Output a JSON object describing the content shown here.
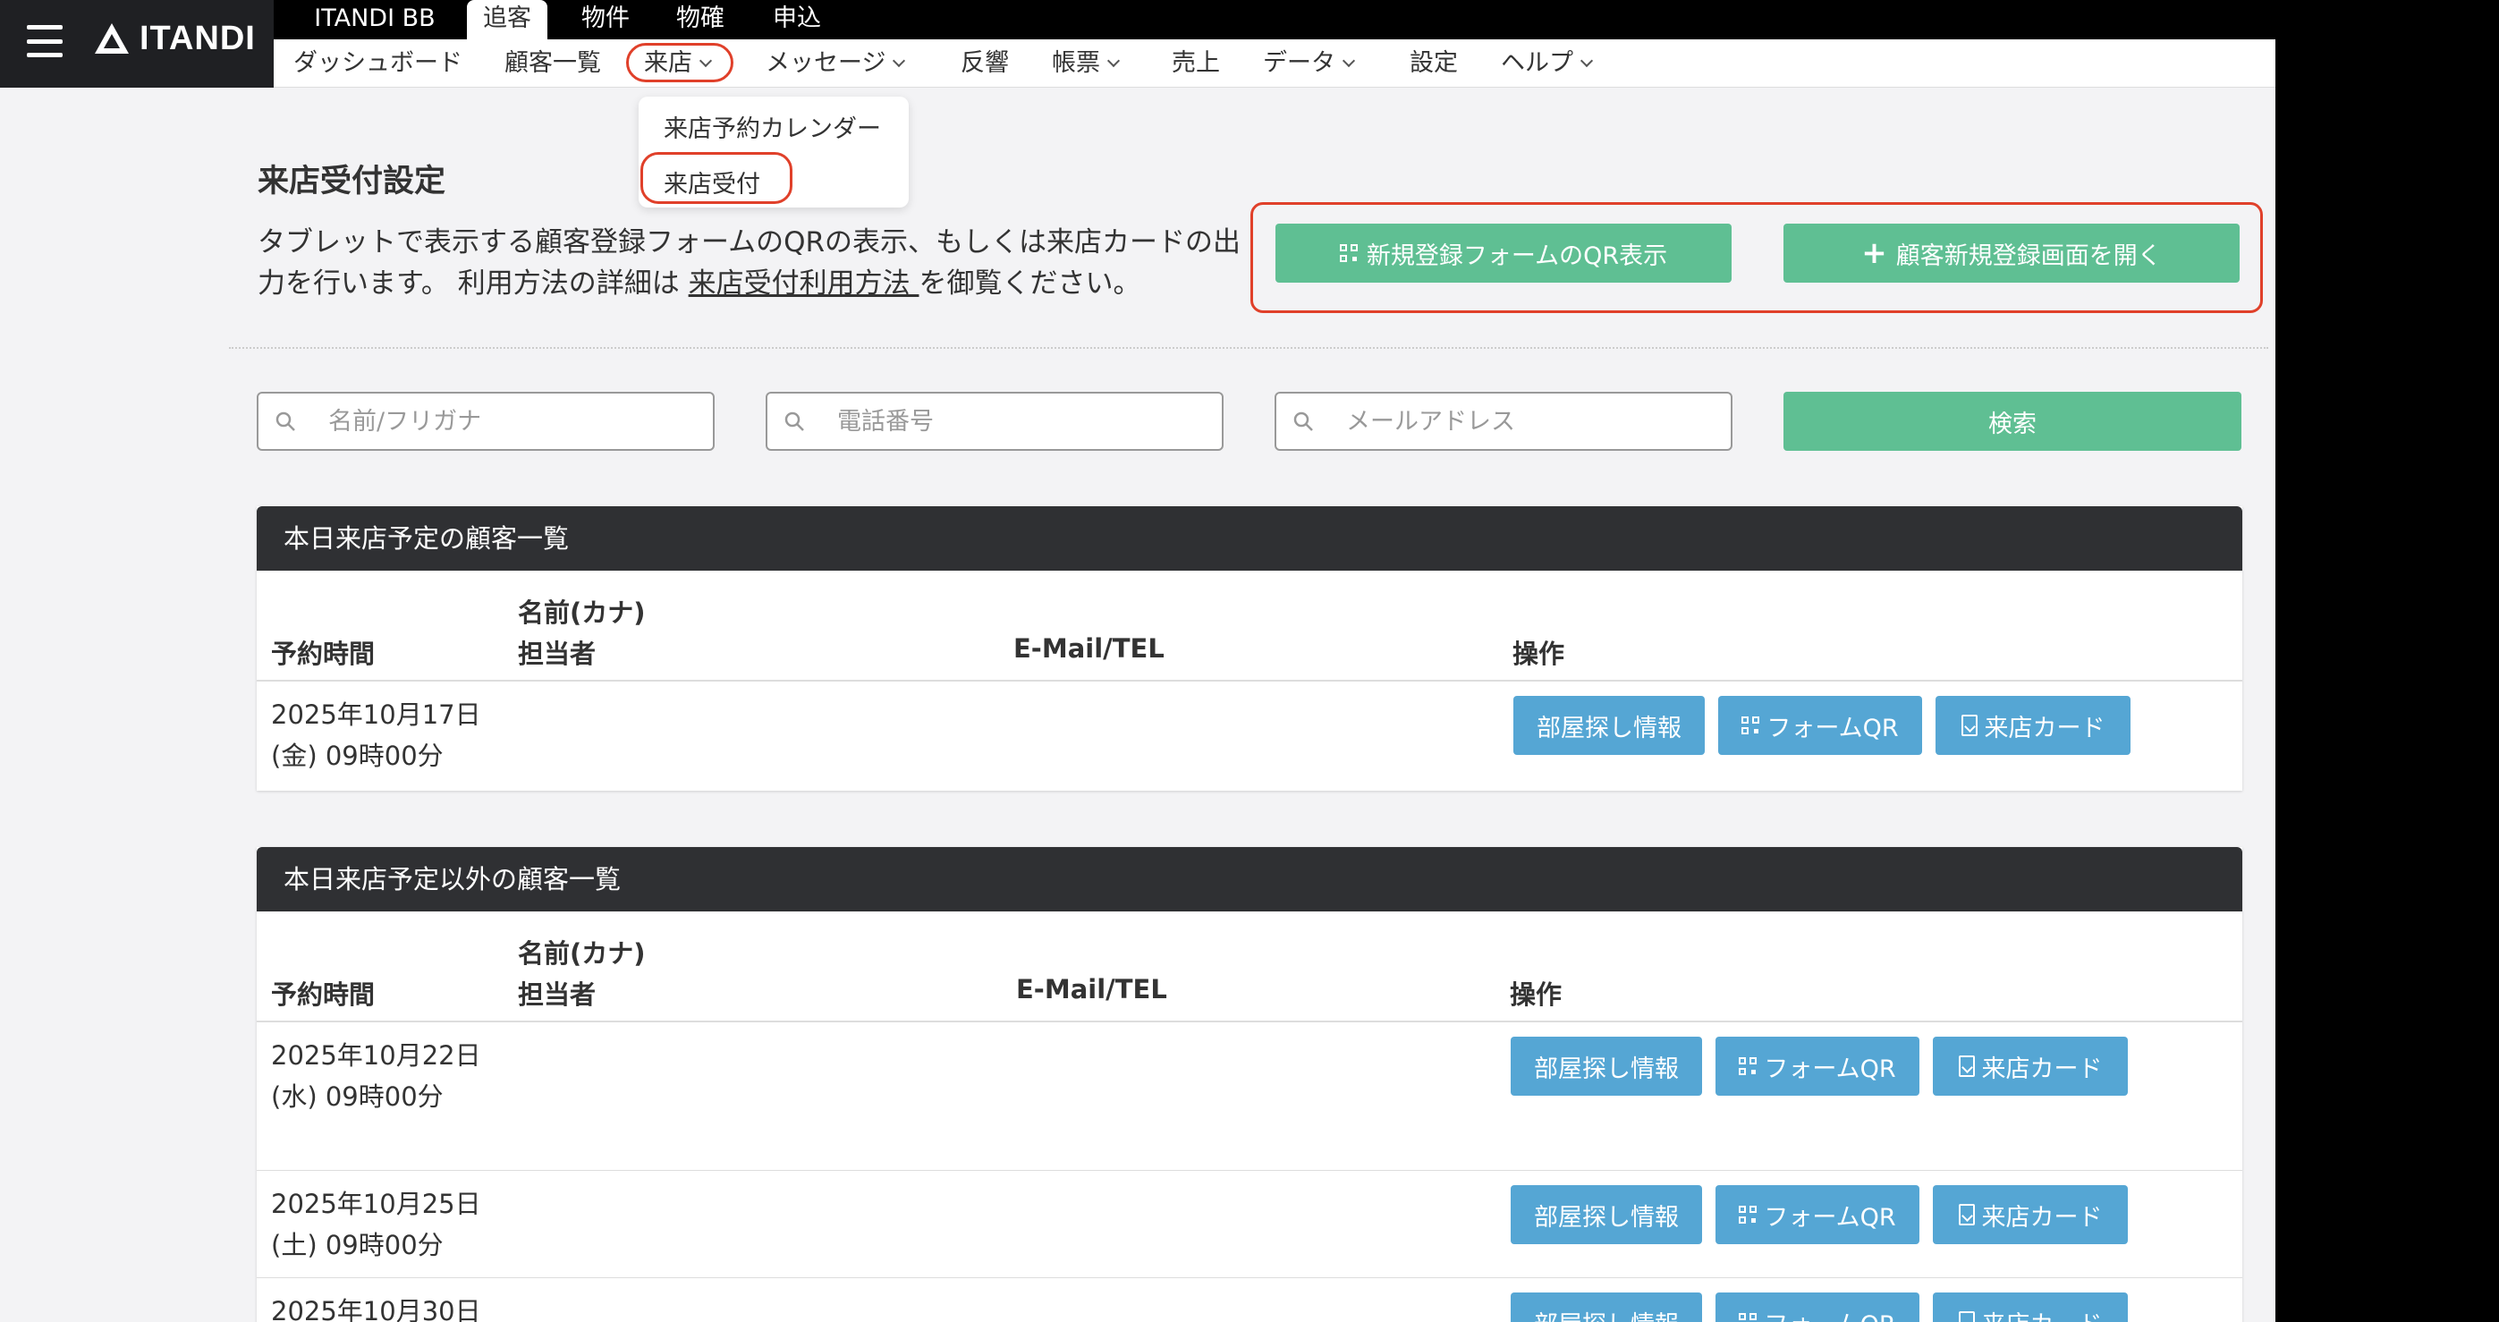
{
  "brand": {
    "logo_text": "ITANDI"
  },
  "categories": [
    {
      "label": "ITANDI BB"
    },
    {
      "label": "追客"
    },
    {
      "label": "物件"
    },
    {
      "label": "物確"
    },
    {
      "label": "申込"
    }
  ],
  "subnav": [
    {
      "label": "ダッシュボード"
    },
    {
      "label": "顧客一覧"
    },
    {
      "label": "来店"
    },
    {
      "label": "メッセージ"
    },
    {
      "label": "反響"
    },
    {
      "label": "帳票"
    },
    {
      "label": "売上"
    },
    {
      "label": "データ"
    },
    {
      "label": "設定"
    },
    {
      "label": "ヘルプ"
    }
  ],
  "dropdown": {
    "items": [
      {
        "label": "来店予約カレンダー"
      },
      {
        "label": "来店受付"
      }
    ]
  },
  "page": {
    "title": "来店受付設定",
    "desc1": "タブレットで表示する顧客登録フォームのQRの表示、もしくは来店カードの出力を行います。 利用方法の詳細は ",
    "desc_link": "来店受付利用方法 ",
    "desc2": "を御覧ください。",
    "qr_button": "新規登録フォームのQR表示",
    "new_customer_button": "顧客新規登録画面を開く"
  },
  "search": {
    "name_placeholder": "名前/フリガナ",
    "phone_placeholder": "電話番号",
    "email_placeholder": "メールアドレス",
    "button": "検索"
  },
  "columns": {
    "time": "予約時間",
    "name": "名前(カナ)",
    "staff": "担当者",
    "contact": "E-Mail/TEL",
    "ops": "操作"
  },
  "row_buttons": {
    "room": "部屋探し情報",
    "form_qr": "フォームQR",
    "card": "来店カード"
  },
  "today": {
    "title": "本日来店予定の顧客一覧",
    "rows": [
      {
        "date": "2025年10月17日",
        "time": "(金) 09時00分"
      }
    ]
  },
  "others": {
    "title": "本日来店予定以外の顧客一覧",
    "rows": [
      {
        "date": "2025年10月22日",
        "time": "(水) 09時00分"
      },
      {
        "date": "2025年10月25日",
        "time": "(土) 09時00分"
      },
      {
        "date": "2025年10月30日",
        "time": ""
      }
    ]
  },
  "colors": {
    "green": "#5fbf93",
    "blue": "#55a6d4",
    "dark": "#2f3033",
    "highlight": "#e0402a"
  }
}
